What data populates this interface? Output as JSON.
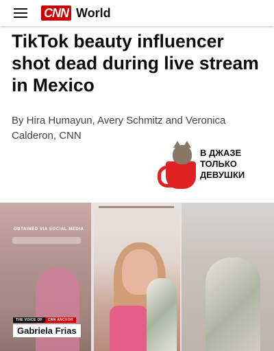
{
  "header": {
    "logo_text": "CNN",
    "section": "World",
    "menu_icon": "hamburger-menu-icon",
    "brand_color": "#cc0000"
  },
  "article": {
    "headline": "TikTok beauty influencer shot dead during live stream in Mexico",
    "byline": "By Hira Humayun, Avery Schmitz and Veronica Calderon, CNN"
  },
  "sticker": {
    "lines": [
      "В ДЖАЗЕ",
      "ТОЛЬКО",
      "ДЕВУШКИ"
    ],
    "icon": "cat-in-mug-icon"
  },
  "video": {
    "overlay_text": "OBTAINED VIA SOCIAL MEDIA",
    "tag_left": "THE VOICE OF",
    "tag_right": "CNN ANCHOR",
    "anchor_name": "Gabriela Frias"
  }
}
